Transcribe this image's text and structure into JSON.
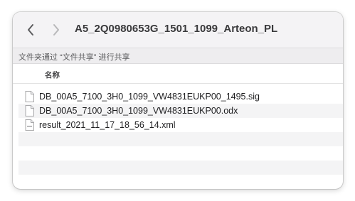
{
  "window": {
    "title": "A5_2Q0980653G_1501_1099_Arteon_PL"
  },
  "banner": {
    "text": "文件夹通过 “文件共享” 进行共享"
  },
  "list_header": {
    "name_column": "名称"
  },
  "files": [
    {
      "name": "DB_00A5_7100_3H0_1099_VW4831EUKP00_1495.sig",
      "icon": "document-icon"
    },
    {
      "name": "DB_00A5_7100_3H0_1099_VW4831EUKP00.odx",
      "icon": "document-icon"
    },
    {
      "name": "result_2021_11_17_18_56_14.xml",
      "icon": "xml-document-icon"
    }
  ],
  "colors": {
    "titlebar": "#f4f3f5",
    "banner": "#eeedef",
    "stripe": "#f4f4f5",
    "text": "#1d1d1f"
  }
}
